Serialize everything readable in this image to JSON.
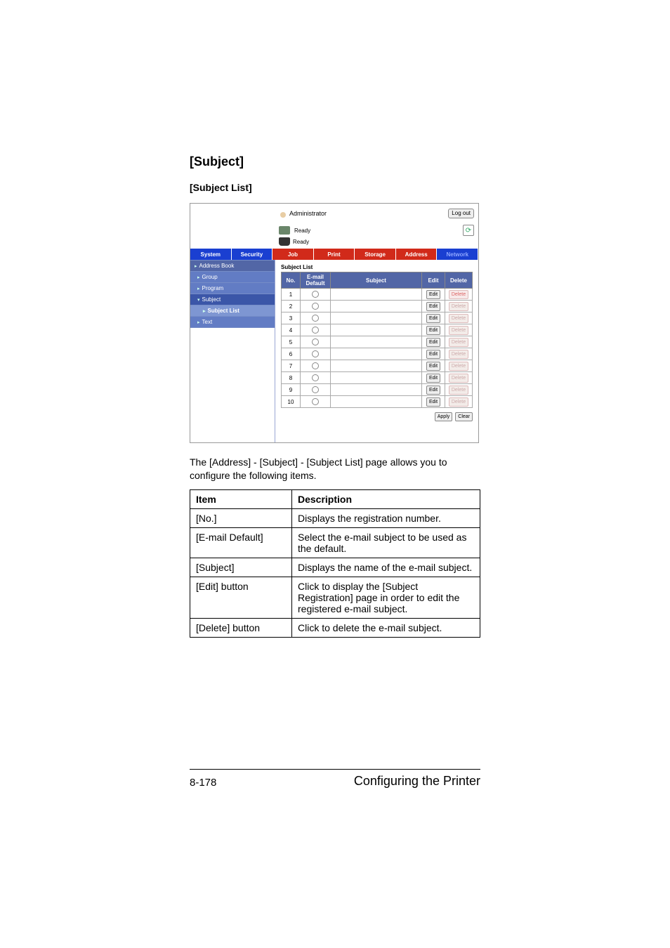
{
  "headings": {
    "h1": "[Subject]",
    "h2": "[Subject List]"
  },
  "shot": {
    "adminLabel": "Administrator",
    "logout": "Log out",
    "ready1": "Ready",
    "ready2": "Ready",
    "tabs": {
      "system": "System",
      "security": "Security",
      "job": "Job",
      "print": "Print",
      "storage": "Storage",
      "address": "Address",
      "network": "Network"
    },
    "sidebar": {
      "addressBook": "Address Book",
      "group": "Group",
      "program": "Program",
      "subject": "Subject",
      "subjectList": "Subject List",
      "text": "Text"
    },
    "subjectListTitle": "Subject List",
    "cols": {
      "no": "No.",
      "emailDefault": "E-mail Default",
      "subject": "Subject",
      "edit": "Edit",
      "delete": "Delete"
    },
    "rows": [
      1,
      2,
      3,
      4,
      5,
      6,
      7,
      8,
      9,
      10
    ],
    "editBtn": "Edit",
    "deleteBtn": "Delete",
    "apply": "Apply",
    "clear": "Clear"
  },
  "paragraph": "The [Address] - [Subject] - [Subject List] page allows you to configure the following items.",
  "descTable": {
    "head": {
      "item": "Item",
      "desc": "Description"
    },
    "rows": [
      {
        "item": "[No.]",
        "desc": "Displays the registration number."
      },
      {
        "item": "[E-mail Default]",
        "desc": "Select the e-mail subject to be used as the default."
      },
      {
        "item": "[Subject]",
        "desc": "Displays the name of the e-mail subject."
      },
      {
        "item": "[Edit] button",
        "desc": "Click to display the [Subject Registration] page in order to edit the registered e-mail subject."
      },
      {
        "item": "[Delete] button",
        "desc": "Click to delete the e-mail subject."
      }
    ]
  },
  "footer": {
    "pageNum": "8-178",
    "sectionTitle": "Configuring the Printer"
  }
}
